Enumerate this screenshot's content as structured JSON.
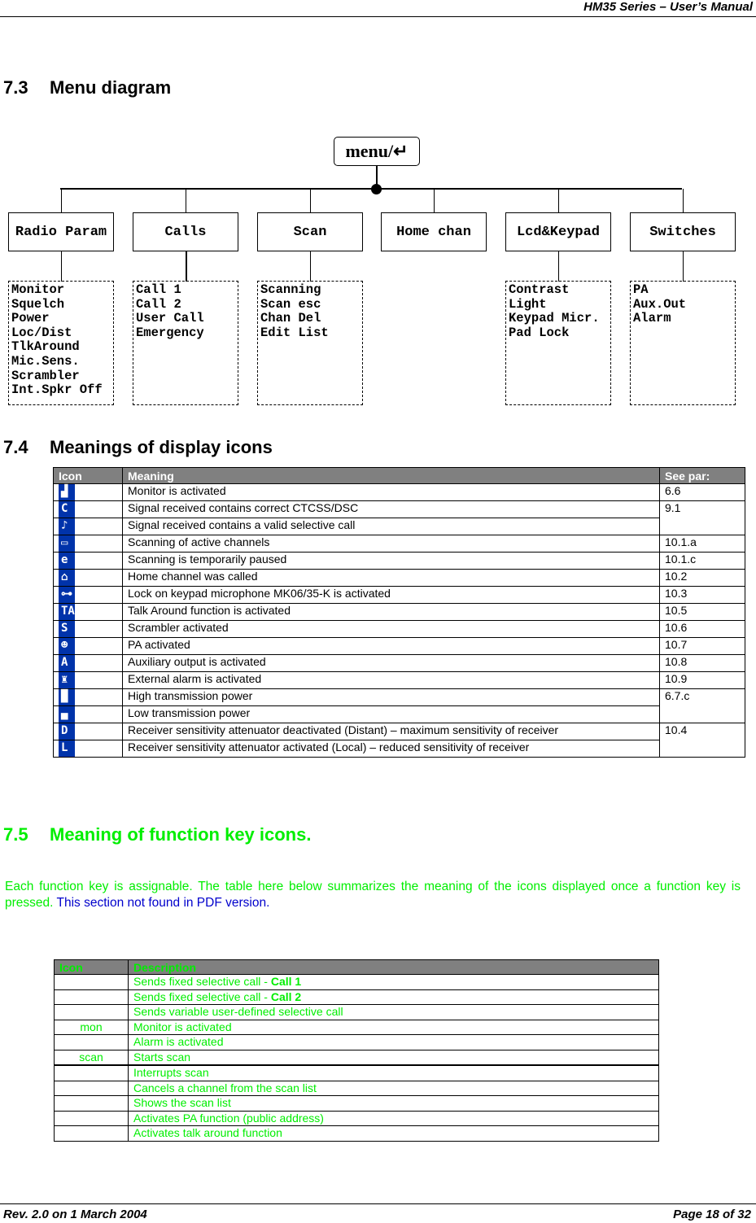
{
  "header": {
    "title": "HM35 Series – User’s Manual"
  },
  "footer": {
    "revision": "Rev. 2.0 on 1 March 2004",
    "page": "Page 18 of 32"
  },
  "section_7_3": {
    "number": "7.3",
    "title": "Menu diagram",
    "root": "menu/↵",
    "categories": [
      {
        "label": "Radio Param",
        "items": [
          "Monitor",
          "Squelch",
          "Power",
          "Loc/Dist",
          "TlkAround",
          "Mic.Sens.",
          "Scrambler",
          "Int.Spkr Off"
        ]
      },
      {
        "label": "Calls",
        "items": [
          "Call 1",
          "Call 2",
          "User Call",
          "Emergency"
        ]
      },
      {
        "label": "Scan",
        "items": [
          "Scanning",
          "Scan esc",
          "Chan Del",
          "Edit List"
        ]
      },
      {
        "label": "Home chan",
        "items": []
      },
      {
        "label": "Lcd&Keypad",
        "items": [
          "Contrast",
          "Light",
          "Keypad Micr.",
          "Pad Lock"
        ]
      },
      {
        "label": "Switches",
        "items": [
          "PA",
          "Aux.Out",
          "Alarm"
        ]
      }
    ]
  },
  "section_7_4": {
    "number": "7.4",
    "title": "Meanings of display icons",
    "columns": [
      "Icon",
      "Meaning",
      "See par:"
    ],
    "rows": [
      {
        "icon": "monitor-icon",
        "glyph": "▟",
        "meaning": "Monitor is activated",
        "par": "6.6"
      },
      {
        "icon": "ctcss-icon",
        "glyph": "C",
        "meaning": "Signal received contains correct CTCSS/DSC",
        "par": "9.1"
      },
      {
        "icon": "selective-call-icon",
        "glyph": "♪",
        "meaning": "Signal received contains a valid selective call",
        "par": ""
      },
      {
        "icon": "scan-icon",
        "glyph": "▭",
        "meaning": "Scanning of active channels",
        "par": "10.1.a"
      },
      {
        "icon": "scan-pause-icon",
        "glyph": "e",
        "meaning": "Scanning is temporarily paused",
        "par": "10.1.c"
      },
      {
        "icon": "home-icon",
        "glyph": "⌂",
        "meaning": "Home channel was called",
        "par": "10.2"
      },
      {
        "icon": "keypad-lock-icon",
        "glyph": "⊶",
        "meaning": "Lock on keypad microphone MK06/35-K is activated",
        "par": "10.3"
      },
      {
        "icon": "talk-around-icon",
        "glyph": "TA",
        "meaning": "Talk Around function is activated",
        "par": "10.5"
      },
      {
        "icon": "scrambler-icon",
        "glyph": "S",
        "meaning": "Scrambler activated",
        "par": "10.6"
      },
      {
        "icon": "pa-icon",
        "glyph": "☻",
        "meaning": "PA activated",
        "par": "10.7"
      },
      {
        "icon": "aux-output-icon",
        "glyph": "A",
        "meaning": "Auxiliary output is activated",
        "par": "10.8"
      },
      {
        "icon": "alarm-icon",
        "glyph": "♜",
        "meaning": "External alarm is activated",
        "par": "10.9"
      },
      {
        "icon": "high-power-icon",
        "glyph": "█",
        "meaning": "High transmission power",
        "par": "6.7.c"
      },
      {
        "icon": "low-power-icon",
        "glyph": "▄",
        "meaning": "Low transmission power",
        "par": ""
      },
      {
        "icon": "distant-icon",
        "glyph": "D",
        "meaning": "Receiver sensitivity attenuator deactivated (Distant) – maximum sensitivity of receiver",
        "par": "10.4"
      },
      {
        "icon": "local-icon",
        "glyph": "L",
        "meaning": "Receiver sensitivity attenuator activated (Local) – reduced sensitivity of receiver",
        "par": ""
      }
    ]
  },
  "section_7_5": {
    "number": "7.5",
    "title": "Meaning of function key icons.",
    "paragraph": "Each function key is assignable. The  table here below summarizes the meaning of the icons displayed once a function key is pressed. ",
    "note": " This section not found in PDF version.",
    "columns": [
      "Icon",
      "Description"
    ],
    "rows": [
      {
        "icon": "",
        "text": "Sends fixed selective call - ",
        "bold": "Call 1"
      },
      {
        "icon": "",
        "text": "Sends fixed selective call - ",
        "bold": "Call 2"
      },
      {
        "icon": "",
        "text": "Sends variable user-defined selective call",
        "bold": ""
      },
      {
        "icon": "mon",
        "text": "Monitor is activated",
        "bold": ""
      },
      {
        "icon": "",
        "text": "Alarm is activated",
        "bold": ""
      },
      {
        "icon": "scan",
        "text": "Starts scan",
        "bold": ""
      },
      {
        "icon": "",
        "text": "Interrupts scan",
        "bold": ""
      },
      {
        "icon": "",
        "text": "Cancels a channel from the scan list",
        "bold": ""
      },
      {
        "icon": "",
        "text": "Shows the scan list",
        "bold": ""
      },
      {
        "icon": "",
        "text": "Activates PA function (public address)",
        "bold": ""
      },
      {
        "icon": "",
        "text": "Activates talk around function",
        "bold": ""
      }
    ]
  },
  "colors": {
    "lcd_icon": "#0033aa",
    "header_bg": "#808080",
    "highlight_green": "#00ee00",
    "note_blue": "#0000cc"
  }
}
